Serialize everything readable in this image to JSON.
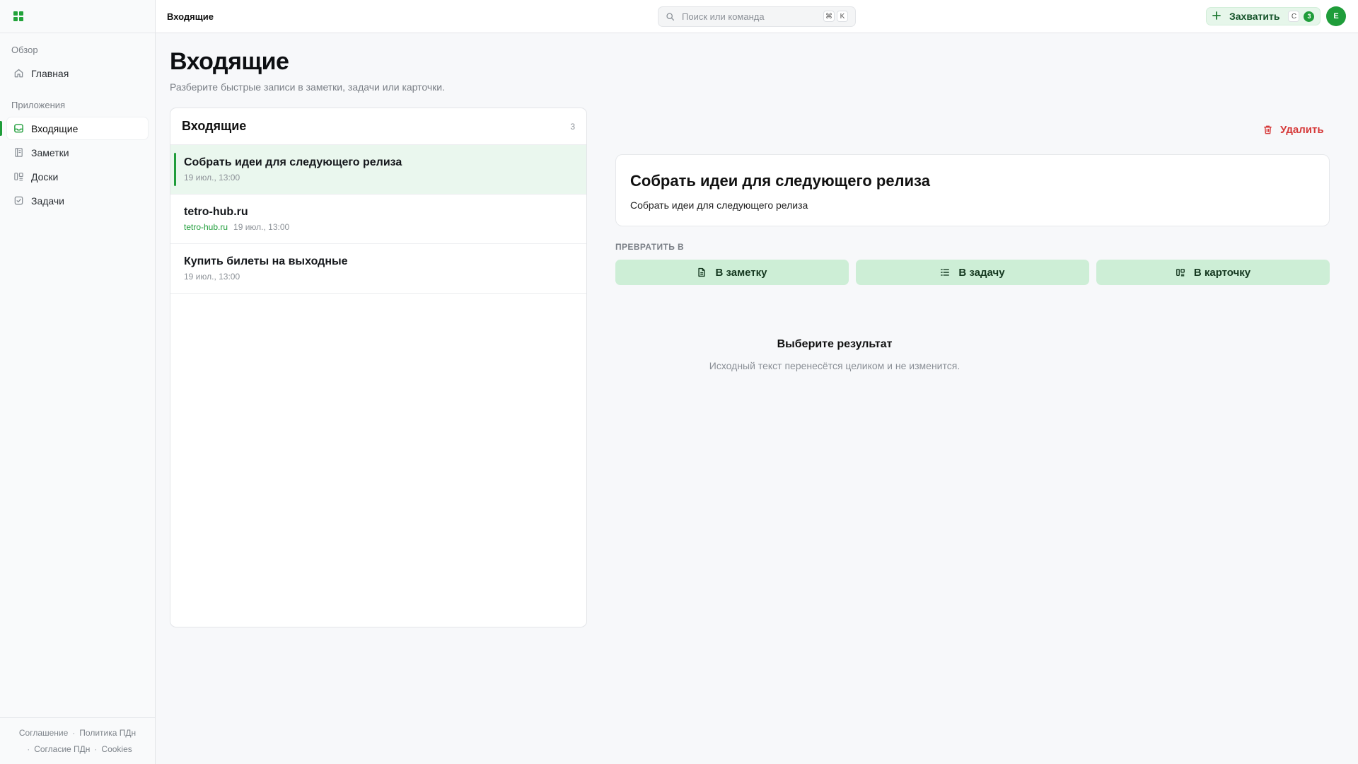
{
  "sidebar": {
    "sections": [
      {
        "label": "Обзор"
      },
      {
        "label": "Приложения"
      }
    ],
    "items": [
      {
        "label": "Главная",
        "icon": "home-icon"
      },
      {
        "label": "Входящие",
        "icon": "inbox-icon",
        "active": true
      },
      {
        "label": "Заметки",
        "icon": "notes-icon"
      },
      {
        "label": "Доски",
        "icon": "boards-icon"
      },
      {
        "label": "Задачи",
        "icon": "tasks-icon"
      }
    ],
    "footer": {
      "agreement": "Соглашение",
      "privacy": "Политика ПДн",
      "consent": "Согласие ПДн",
      "cookies": "Cookies"
    }
  },
  "topbar": {
    "breadcrumb": "Входящие",
    "search_placeholder": "Поиск или команда",
    "search_kbd_1": "⌘",
    "search_kbd_2": "K",
    "capture_label": "Захватить",
    "capture_kbd": "C",
    "capture_count": "3",
    "avatar_initial": "E"
  },
  "page": {
    "title": "Входящие",
    "subtitle": "Разберите быстрые записи в заметки, задачи или карточки."
  },
  "list": {
    "title": "Входящие",
    "count": "3",
    "items": [
      {
        "title": "Собрать идеи для следующего релиза",
        "domain": "",
        "time": "19 июл., 13:00"
      },
      {
        "title": "tetro-hub.ru",
        "domain": "tetro-hub.ru",
        "time": "19 июл., 13:00"
      },
      {
        "title": "Купить билеты на выходные",
        "domain": "",
        "time": "19 июл., 13:00"
      }
    ]
  },
  "detail": {
    "delete_label": "Удалить",
    "title": "Собрать идеи для следующего релиза",
    "body": "Собрать идеи для следующего релиза",
    "convert_label": "ПРЕВРАТИТЬ В",
    "convert_note": "В заметку",
    "convert_task": "В задачу",
    "convert_card": "В карточку",
    "empty_title": "Выберите результат",
    "empty_sub": "Исходный текст перенесётся целиком и не изменится."
  },
  "colors": {
    "accent": "#1f9d3a",
    "accent_light": "#cdeed6",
    "selected_row": "#eaf7ee",
    "danger": "#d63a3a"
  }
}
